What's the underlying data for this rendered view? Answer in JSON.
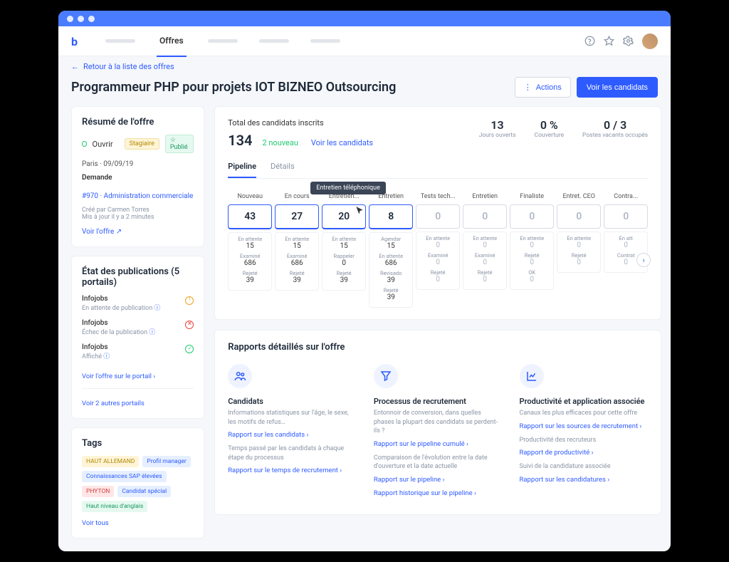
{
  "nav": {
    "active_tab": "Offres",
    "back_link": "Retour à la liste des offres"
  },
  "header": {
    "title": "Programmeur PHP pour projets IOT BIZNEO Outsourcing",
    "actions_btn": "Actions",
    "view_candidates_btn": "Voir les candidats"
  },
  "summary": {
    "title": "Résumé de l'offre",
    "open_label": "Ouvrir",
    "badge1": "Stagiaire",
    "badge2": "Publié",
    "location_date": "Paris · 09/09/19",
    "demand_label": "Demande",
    "demand_link": "#970 · Administration commerciale",
    "created_by": "Créé par Carmen Torres",
    "updated": "Mis à jour il y a 2 minutes",
    "view_offer": "Voir l'offre"
  },
  "publications": {
    "title": "État des publications (5 portails)",
    "items": [
      {
        "name": "Infojobs",
        "status": "En attente de publication",
        "icon": "warn"
      },
      {
        "name": "Infojobs",
        "status": "Échec de la publication",
        "icon": "err"
      },
      {
        "name": "Infojobs",
        "status": "Affiché",
        "icon": "ok"
      }
    ],
    "view_portal": "Voir l'offre sur le portail",
    "view_more": "Voir 2 autres portails"
  },
  "tags": {
    "title": "Tags",
    "items": [
      {
        "text": "HAUT ALLEMAND",
        "style": "t-yellow"
      },
      {
        "text": "Profil manager",
        "style": "t-blue"
      },
      {
        "text": "Connaissances SAP élevées",
        "style": "t-blue"
      },
      {
        "text": "PHYTON",
        "style": "t-red"
      },
      {
        "text": "Candidat spécial",
        "style": "t-blue"
      },
      {
        "text": "Haut niveau d'anglais",
        "style": "t-green"
      }
    ],
    "view_all": "Voir tous"
  },
  "stats": {
    "total_label": "Total des candidats inscrits",
    "total": "134",
    "new": "2 nouveau",
    "view_link": "Voir les candidats",
    "kpis": [
      {
        "val": "13",
        "lbl": "Jours ouverts"
      },
      {
        "val": "0 %",
        "lbl": "Couverture"
      },
      {
        "val": "0 / 3",
        "lbl": "Postes vacants occupés"
      }
    ],
    "tabs": [
      "Pipeline",
      "Détails"
    ],
    "tooltip": "Entretien téléphonique"
  },
  "pipeline": [
    {
      "name": "Nouveau",
      "count": "43",
      "active": true,
      "subs": [
        [
          "En attente",
          "15"
        ],
        [
          "Examiné",
          "686"
        ],
        [
          "Rejeté",
          "39"
        ]
      ]
    },
    {
      "name": "En cours",
      "count": "27",
      "active": true,
      "subs": [
        [
          "En attente",
          "15"
        ],
        [
          "Examiné",
          "686"
        ],
        [
          "Rejeté",
          "39"
        ]
      ]
    },
    {
      "name": "Entretien...",
      "count": "20",
      "active": true,
      "subs": [
        [
          "En attente",
          "15"
        ],
        [
          "Rappeler",
          "0"
        ],
        [
          "Rejeté",
          "39"
        ]
      ]
    },
    {
      "name": "Entretien",
      "count": "8",
      "active": true,
      "subs": [
        [
          "Agendar",
          "15"
        ],
        [
          "En attente",
          "686"
        ],
        [
          "Revisado",
          "39"
        ],
        [
          "Rejeté",
          "39"
        ]
      ]
    },
    {
      "name": "Tests tech...",
      "count": "0",
      "active": false,
      "subs": [
        [
          "En attente",
          "0"
        ],
        [
          "Examiné",
          "0"
        ],
        [
          "Rejeté",
          "0"
        ]
      ]
    },
    {
      "name": "Entretien",
      "count": "0",
      "active": false,
      "subs": [
        [
          "En attente",
          "0"
        ],
        [
          "Examiné",
          "0"
        ],
        [
          "Rejeté",
          "0"
        ]
      ]
    },
    {
      "name": "Finaliste",
      "count": "0",
      "active": false,
      "subs": [
        [
          "En attente",
          "0"
        ],
        [
          "Rejeté",
          "0"
        ],
        [
          "OK",
          "0"
        ]
      ]
    },
    {
      "name": "Entret. CEO",
      "count": "0",
      "active": false,
      "subs": [
        [
          "En attente",
          "0"
        ],
        [
          "Rejeté",
          "0"
        ]
      ]
    },
    {
      "name": "Contra...",
      "count": "0",
      "active": false,
      "subs": [
        [
          "En att",
          "0"
        ],
        [
          "Contrat",
          "0"
        ]
      ]
    }
  ],
  "reports": {
    "title": "Rapports détaillés sur l'offre",
    "cols": [
      {
        "icon": "users",
        "heading": "Candidats",
        "blocks": [
          {
            "desc": "Informations statistiques sur l'âge, le sexe, les motifs de refus…",
            "link": "Rapport sur les candidats"
          },
          {
            "desc": "Temps passé par les candidats à chaque étape du processus",
            "link": "Rapport sur le temps de recrutement"
          }
        ]
      },
      {
        "icon": "funnel",
        "heading": "Processus de recrutement",
        "blocks": [
          {
            "desc": "Entonnoir de conversion, dans quelles phases la plupart des candidats se perdent-ils ?",
            "link": "Rapport sur le pipeline cumulé"
          },
          {
            "desc": "Comparaison de l'évolution entre la date d'ouverture et la date actuelle",
            "link": "Rapport sur le pipeline"
          },
          {
            "desc": "",
            "link": "Rapport historique sur le pipeline"
          }
        ]
      },
      {
        "icon": "chart",
        "heading": "Productivité et application associée",
        "blocks": [
          {
            "desc": "Canaux les plus efficaces pour cette offre",
            "link": "Rapport sur les sources de recrutement"
          },
          {
            "desc": "Productivité des recruteurs",
            "link": "Rapport de productivité"
          },
          {
            "desc": "Suivi de la candidature associée",
            "link": "Rapport sur les candidatures"
          }
        ]
      }
    ]
  }
}
